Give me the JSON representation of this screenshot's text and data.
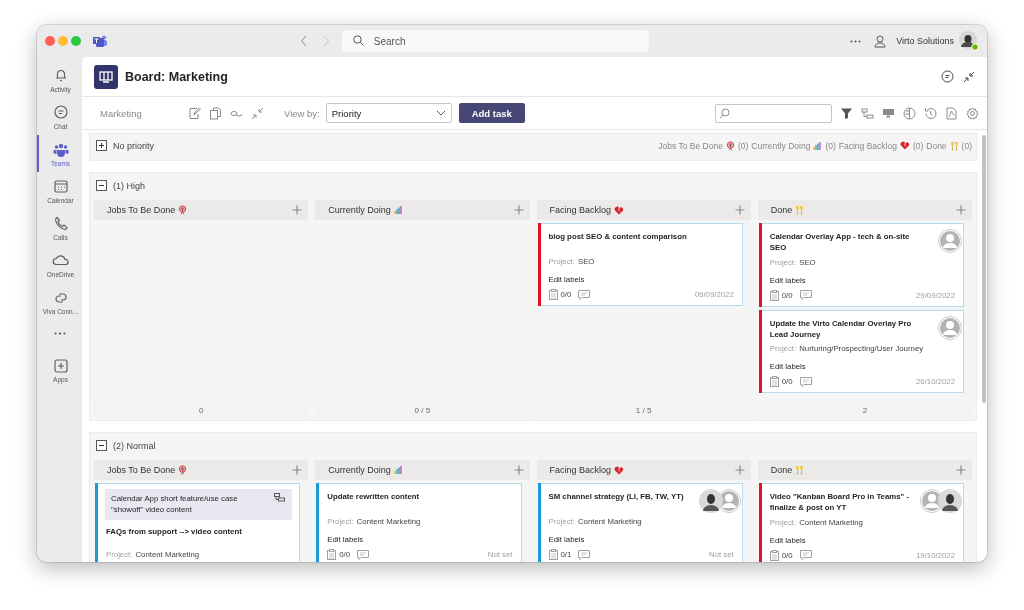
{
  "titlebar": {
    "search": {
      "placeholder": "Search"
    },
    "account": {
      "name": "Virto Solutions",
      "online": true
    }
  },
  "rail": [
    {
      "label": "Activity",
      "selected": false
    },
    {
      "label": "Chat",
      "selected": false
    },
    {
      "label": "Teams",
      "selected": true
    },
    {
      "label": "Calendar",
      "selected": false
    },
    {
      "label": "Calls",
      "selected": false
    },
    {
      "label": "OneDrive",
      "selected": false
    },
    {
      "label": "Viva Conn...",
      "selected": false
    },
    {
      "label": "Apps",
      "selected": false
    }
  ],
  "board": {
    "title": "Board: Marketing"
  },
  "toolbar": {
    "team": "Marketing",
    "view_by_label": "View by:",
    "view_by_value": "Priority",
    "add_button": "Add task"
  },
  "groups": [
    {
      "title": "No priority",
      "expanded": false,
      "summary": [
        {
          "label": "Jobs To Be Done",
          "count": "(0)"
        },
        {
          "label": "Currently Doing",
          "count": "(0)"
        },
        {
          "label": "Facing Backlog",
          "count": "(0)"
        },
        {
          "label": "Done",
          "count": "(0)"
        }
      ]
    },
    {
      "title": "(1) High",
      "expanded": true,
      "columns": [
        {
          "title": "Jobs To Be Done",
          "footer": "0"
        },
        {
          "title": "Currently Doing",
          "footer": "0 / 5"
        },
        {
          "title": "Facing Backlog",
          "footer": "1 / 5",
          "cards": [
            {
              "title": "blog post SEO & content comparison",
              "project_label": "Project:",
              "project": "SEO",
              "labels_link": "Edit labels",
              "checklist": "0/0",
              "date": "09/09/2022",
              "color": "#e81123"
            }
          ]
        },
        {
          "title": "Done",
          "footer": "2",
          "cards": [
            {
              "title": "Calendar Overlay App - tech & on-site SEO",
              "project_label": "Project:",
              "project": "SEO",
              "labels_link": "Edit labels",
              "checklist": "0/0",
              "date": "29/09/2022",
              "color": "#e81123",
              "avatars": [
                {
                  "kind": "blank"
                }
              ]
            },
            {
              "title": "Update the Virto Calendar Overlay Pro Lead Journey",
              "project_label": "Project:",
              "project": "Nurturing/Prospecting/User Journey",
              "labels_link": "Edit labels",
              "checklist": "0/0",
              "date": "26/10/2022",
              "color": "#e81123",
              "avatars": [
                {
                  "kind": "blank"
                }
              ]
            }
          ]
        }
      ]
    },
    {
      "title": "(2) Normal",
      "expanded": true,
      "columns": [
        {
          "title": "Jobs To Be Done",
          "cards": [
            {
              "subtask": "Calendar App short feature/use case \"showoff\" video content",
              "title": "FAQs from support --> video content",
              "project_label": "Project:",
              "project": "Content Marketing",
              "color": "#1a9bd7"
            }
          ]
        },
        {
          "title": "Currently Doing",
          "cards": [
            {
              "title": "Update rewritten content",
              "project_label": "Project:",
              "project": "Content Marketing",
              "labels_link": "Edit labels",
              "checklist": "0/0",
              "date": "Not set",
              "color": "#1a9bd7"
            }
          ]
        },
        {
          "title": "Facing Backlog",
          "cards": [
            {
              "title": "SM channel strategy (LI, FB, TW, YT)",
              "project_label": "Project:",
              "project": "Content Marketing",
              "labels_link": "Edit labels",
              "checklist": "0/1",
              "date": "Not set",
              "color": "#1a9bd7",
              "avatars": [
                {
                  "kind": "photo"
                },
                {
                  "kind": "blank"
                }
              ]
            }
          ]
        },
        {
          "title": "Done",
          "cards": [
            {
              "title": "Video \"Kanban Board Pro in Teams\" - finalize & post on YT",
              "project_label": "Project:",
              "project": "Content Marketing",
              "labels_link": "Edit labels",
              "checklist": "0/0",
              "date": "19/10/2022",
              "color": "#e81123",
              "avatars": [
                {
                  "kind": "blank"
                },
                {
                  "kind": "photo"
                }
              ]
            }
          ]
        }
      ]
    }
  ]
}
